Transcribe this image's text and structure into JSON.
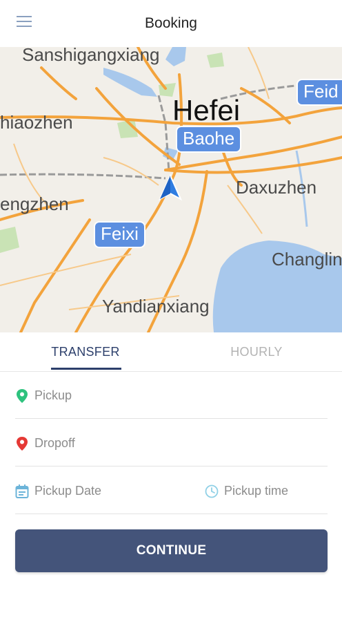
{
  "header": {
    "title": "Booking",
    "menu_icon": "hamburger-menu-icon"
  },
  "map": {
    "places": {
      "sanshigangxiang": "Sanshigangxiang",
      "hefei": "Hefei",
      "baohe": "Baohe",
      "feid": "Feid",
      "miaozhen": "hiaozhen",
      "daxuzhen": "Daxuzhen",
      "fengzhen": "engzhen",
      "feixi": "Feixi",
      "changlin": "Changlin",
      "yandianxiang": "Yandianxiang"
    },
    "location_icon": "navigation-arrow-icon"
  },
  "tabs": {
    "transfer": "TRANSFER",
    "hourly": "HOURLY",
    "active": "transfer"
  },
  "form": {
    "pickup_placeholder": "Pickup",
    "dropoff_placeholder": "Dropoff",
    "pickup_date_placeholder": "Pickup Date",
    "pickup_time_placeholder": "Pickup time"
  },
  "actions": {
    "continue_label": "CONTINUE"
  },
  "colors": {
    "primary": "#44547a",
    "tab_active": "#2c3f6b",
    "pickup_pin": "#2ec27e",
    "dropoff_pin": "#e53935",
    "date_icon": "#6cb4d9",
    "map_badge": "#5c8fe0"
  }
}
